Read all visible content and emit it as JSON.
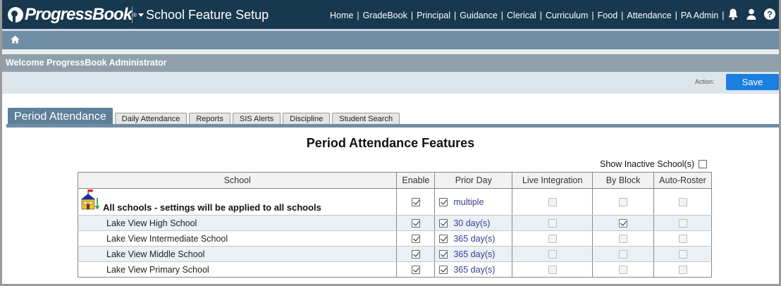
{
  "header": {
    "logo_text": "ProgressBook",
    "logo_mark": "®",
    "app_title": "School Feature Setup",
    "nav": [
      "Home",
      "GradeBook",
      "Principal",
      "Guidance",
      "Clerical",
      "Curriculum",
      "Food",
      "Attendance",
      "PA Admin"
    ],
    "icons": [
      "bell-icon",
      "user-icon",
      "help-icon"
    ]
  },
  "homebar": {
    "icon": "home-icon"
  },
  "welcome_text": "Welcome ProgressBook Administrator",
  "actionbar": {
    "label": "Action:",
    "save_label": "Save"
  },
  "tabs": [
    {
      "label": "Period Attendance",
      "active": true
    },
    {
      "label": "Daily Attendance",
      "active": false
    },
    {
      "label": "Reports",
      "active": false
    },
    {
      "label": "SIS Alerts",
      "active": false
    },
    {
      "label": "Discipline",
      "active": false
    },
    {
      "label": "Student Search",
      "active": false
    }
  ],
  "section_title": "Period Attendance Features",
  "show_inactive": {
    "label": "Show Inactive School(s)",
    "checked": false
  },
  "table": {
    "columns": [
      "School",
      "Enable",
      "Prior Day",
      "Live Integration",
      "By Block",
      "Auto-Roster"
    ],
    "all_row": {
      "label": "All schools - settings will be applied to all schools",
      "enable": true,
      "prior_day_checked": true,
      "prior_day": "multiple",
      "live": false,
      "by_block": false,
      "auto_roster": false
    },
    "rows": [
      {
        "school": "Lake View High School",
        "enable": true,
        "prior_day_checked": true,
        "prior_day": "30 day(s)",
        "live": false,
        "by_block": true,
        "auto_roster": false
      },
      {
        "school": "Lake View Intermediate School",
        "enable": true,
        "prior_day_checked": true,
        "prior_day": "365 day(s)",
        "live": false,
        "by_block": false,
        "auto_roster": false
      },
      {
        "school": "Lake View Middle School",
        "enable": true,
        "prior_day_checked": true,
        "prior_day": "365 day(s)",
        "live": false,
        "by_block": false,
        "auto_roster": false
      },
      {
        "school": "Lake View Primary School",
        "enable": true,
        "prior_day_checked": true,
        "prior_day": "365 day(s)",
        "live": false,
        "by_block": false,
        "auto_roster": false
      }
    ]
  },
  "colors": {
    "header_bg": "#17384f",
    "accent": "#1a7fe0",
    "tab_active": "#5d7f99",
    "row_alt": "#eaf0f5",
    "link": "#3a3d8c"
  }
}
